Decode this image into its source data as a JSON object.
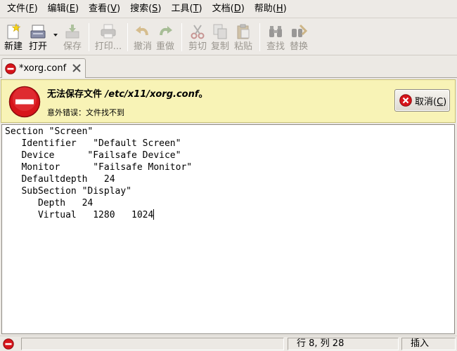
{
  "menubar": {
    "items": [
      {
        "label": "文件(",
        "mnemonic": "F",
        "close": ")"
      },
      {
        "label": "编辑(",
        "mnemonic": "E",
        "close": ")"
      },
      {
        "label": "查看(",
        "mnemonic": "V",
        "close": ")"
      },
      {
        "label": "搜索(",
        "mnemonic": "S",
        "close": ")"
      },
      {
        "label": "工具(",
        "mnemonic": "T",
        "close": ")"
      },
      {
        "label": "文档(",
        "mnemonic": "D",
        "close": ")"
      },
      {
        "label": "帮助(",
        "mnemonic": "H",
        "close": ")"
      }
    ]
  },
  "toolbar": {
    "new_label": "新建",
    "open_label": "打开",
    "save_label": "保存",
    "print_label": "打印...",
    "undo_label": "撤消",
    "redo_label": "重做",
    "cut_label": "剪切",
    "copy_label": "复制",
    "paste_label": "粘贴",
    "find_label": "查找",
    "replace_label": "替换"
  },
  "tab": {
    "label": "*xorg.conf"
  },
  "infobar": {
    "title_prefix": "无法保存文件 ",
    "title_path": "/etc/x11/xorg.conf",
    "title_suffix": "。",
    "subtitle": "意外错误：文件找不到",
    "cancel_label": "取消(",
    "cancel_mnemonic": "C",
    "cancel_close": ")"
  },
  "editor": {
    "lines": [
      "Section \"Screen\"",
      "   Identifier   \"Default Screen\"",
      "   Device      \"Failsafe Device\"",
      "   Monitor      \"Failsafe Monitor\"",
      "   Defaultdepth   24",
      "   SubSection \"Display\"",
      "      Depth   24",
      "      Virtual   1280   1024"
    ]
  },
  "statusbar": {
    "main_text": "",
    "position": "行 8, 列 28",
    "mode": "插入"
  },
  "colors": {
    "infobar_bg": "#f8f3b6",
    "error_red": "#d7141a"
  }
}
